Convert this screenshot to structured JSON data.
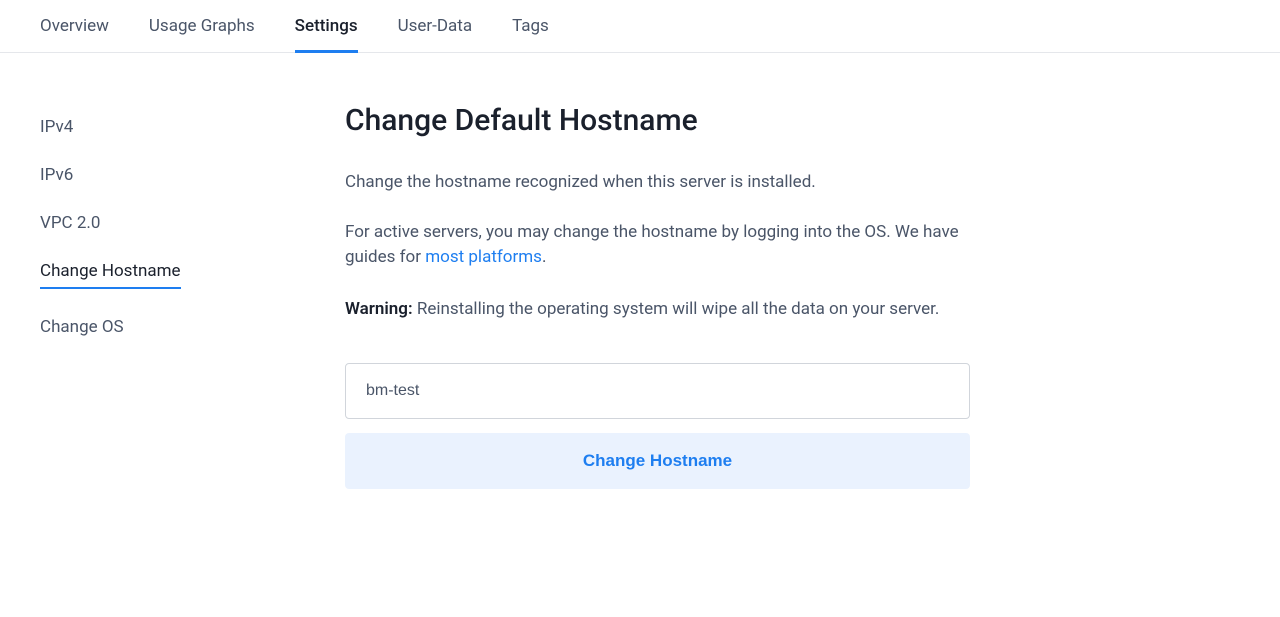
{
  "tabs": [
    {
      "label": "Overview",
      "active": false
    },
    {
      "label": "Usage Graphs",
      "active": false
    },
    {
      "label": "Settings",
      "active": true
    },
    {
      "label": "User-Data",
      "active": false
    },
    {
      "label": "Tags",
      "active": false
    }
  ],
  "sidebar": {
    "items": [
      {
        "label": "IPv4",
        "active": false
      },
      {
        "label": "IPv6",
        "active": false
      },
      {
        "label": "VPC 2.0",
        "active": false
      },
      {
        "label": "Change Hostname",
        "active": true
      },
      {
        "label": "Change OS",
        "active": false
      }
    ]
  },
  "main": {
    "title": "Change Default Hostname",
    "description1": "Change the hostname recognized when this server is installed.",
    "description2_prefix": "For active servers, you may change the hostname by logging into the OS. We have guides for ",
    "description2_link": "most platforms",
    "description2_suffix": ".",
    "warning_label": "Warning:",
    "warning_text": " Reinstalling the operating system will wipe all the data on your server.",
    "hostname_value": "bm-test",
    "button_label": "Change Hostname"
  }
}
